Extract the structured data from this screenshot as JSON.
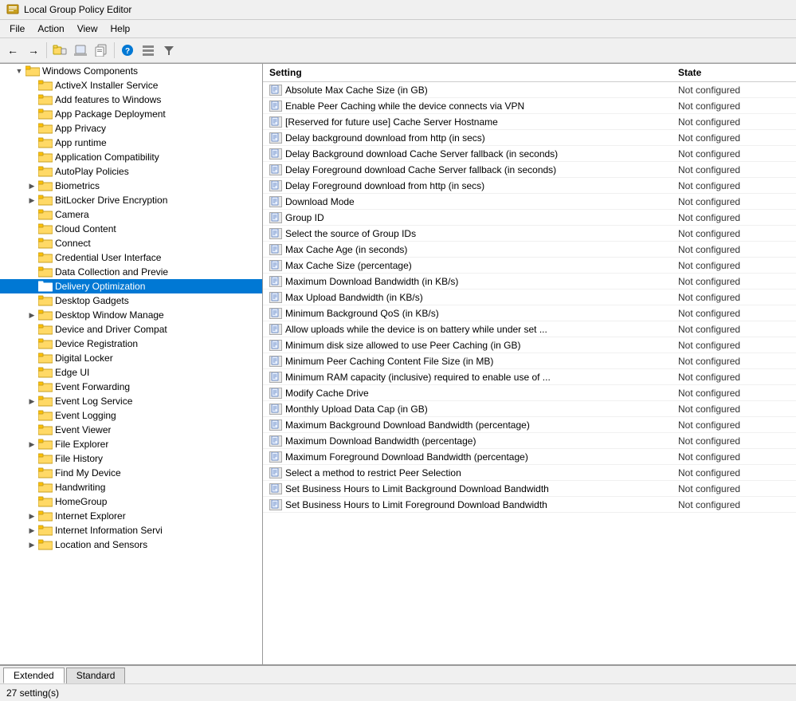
{
  "app": {
    "title": "Local Group Policy Editor",
    "menus": [
      "File",
      "Action",
      "View",
      "Help"
    ]
  },
  "toolbar": {
    "buttons": [
      "◀",
      "▶",
      "📁",
      "📋",
      "📄",
      "❓",
      "📊",
      "▼"
    ]
  },
  "tree": {
    "items": [
      {
        "id": "windows-components",
        "label": "Windows Components",
        "indent": 1,
        "expanded": true,
        "hasChildren": true,
        "selected": false
      },
      {
        "id": "activex",
        "label": "ActiveX Installer Service",
        "indent": 2,
        "expanded": false,
        "hasChildren": false,
        "selected": false
      },
      {
        "id": "add-features",
        "label": "Add features to Windows",
        "indent": 2,
        "expanded": false,
        "hasChildren": false,
        "selected": false
      },
      {
        "id": "app-package",
        "label": "App Package Deployment",
        "indent": 2,
        "expanded": false,
        "hasChildren": false,
        "selected": false
      },
      {
        "id": "app-privacy",
        "label": "App Privacy",
        "indent": 2,
        "expanded": false,
        "hasChildren": false,
        "selected": false
      },
      {
        "id": "app-runtime",
        "label": "App runtime",
        "indent": 2,
        "expanded": false,
        "hasChildren": false,
        "selected": false
      },
      {
        "id": "app-compat",
        "label": "Application Compatibility",
        "indent": 2,
        "expanded": false,
        "hasChildren": false,
        "selected": false
      },
      {
        "id": "autoplay",
        "label": "AutoPlay Policies",
        "indent": 2,
        "expanded": false,
        "hasChildren": false,
        "selected": false
      },
      {
        "id": "biometrics",
        "label": "Biometrics",
        "indent": 2,
        "expanded": false,
        "hasChildren": true,
        "selected": false
      },
      {
        "id": "bitlocker",
        "label": "BitLocker Drive Encryption",
        "indent": 2,
        "expanded": false,
        "hasChildren": true,
        "selected": false
      },
      {
        "id": "camera",
        "label": "Camera",
        "indent": 2,
        "expanded": false,
        "hasChildren": false,
        "selected": false
      },
      {
        "id": "cloud-content",
        "label": "Cloud Content",
        "indent": 2,
        "expanded": false,
        "hasChildren": false,
        "selected": false
      },
      {
        "id": "connect",
        "label": "Connect",
        "indent": 2,
        "expanded": false,
        "hasChildren": false,
        "selected": false
      },
      {
        "id": "credential-ui",
        "label": "Credential User Interface",
        "indent": 2,
        "expanded": false,
        "hasChildren": false,
        "selected": false
      },
      {
        "id": "data-collection",
        "label": "Data Collection and Previe",
        "indent": 2,
        "expanded": false,
        "hasChildren": false,
        "selected": false
      },
      {
        "id": "delivery-opt",
        "label": "Delivery Optimization",
        "indent": 2,
        "expanded": false,
        "hasChildren": false,
        "selected": true
      },
      {
        "id": "desktop-gadgets",
        "label": "Desktop Gadgets",
        "indent": 2,
        "expanded": false,
        "hasChildren": false,
        "selected": false
      },
      {
        "id": "desktop-window",
        "label": "Desktop Window Manage",
        "indent": 2,
        "expanded": false,
        "hasChildren": true,
        "selected": false
      },
      {
        "id": "device-driver",
        "label": "Device and Driver Compat",
        "indent": 2,
        "expanded": false,
        "hasChildren": false,
        "selected": false
      },
      {
        "id": "device-reg",
        "label": "Device Registration",
        "indent": 2,
        "expanded": false,
        "hasChildren": false,
        "selected": false
      },
      {
        "id": "digital-locker",
        "label": "Digital Locker",
        "indent": 2,
        "expanded": false,
        "hasChildren": false,
        "selected": false
      },
      {
        "id": "edge-ui",
        "label": "Edge UI",
        "indent": 2,
        "expanded": false,
        "hasChildren": false,
        "selected": false
      },
      {
        "id": "event-fwd",
        "label": "Event Forwarding",
        "indent": 2,
        "expanded": false,
        "hasChildren": false,
        "selected": false
      },
      {
        "id": "event-log",
        "label": "Event Log Service",
        "indent": 2,
        "expanded": false,
        "hasChildren": true,
        "selected": false
      },
      {
        "id": "event-logging",
        "label": "Event Logging",
        "indent": 2,
        "expanded": false,
        "hasChildren": false,
        "selected": false
      },
      {
        "id": "event-viewer",
        "label": "Event Viewer",
        "indent": 2,
        "expanded": false,
        "hasChildren": false,
        "selected": false
      },
      {
        "id": "file-explorer",
        "label": "File Explorer",
        "indent": 2,
        "expanded": false,
        "hasChildren": true,
        "selected": false
      },
      {
        "id": "file-history",
        "label": "File History",
        "indent": 2,
        "expanded": false,
        "hasChildren": false,
        "selected": false
      },
      {
        "id": "find-my-device",
        "label": "Find My Device",
        "indent": 2,
        "expanded": false,
        "hasChildren": false,
        "selected": false
      },
      {
        "id": "handwriting",
        "label": "Handwriting",
        "indent": 2,
        "expanded": false,
        "hasChildren": false,
        "selected": false
      },
      {
        "id": "homegroup",
        "label": "HomeGroup",
        "indent": 2,
        "expanded": false,
        "hasChildren": false,
        "selected": false
      },
      {
        "id": "internet-explorer",
        "label": "Internet Explorer",
        "indent": 2,
        "expanded": false,
        "hasChildren": true,
        "selected": false
      },
      {
        "id": "internet-info",
        "label": "Internet Information Servi",
        "indent": 2,
        "expanded": false,
        "hasChildren": true,
        "selected": false
      },
      {
        "id": "location-sensors",
        "label": "Location and Sensors",
        "indent": 2,
        "expanded": false,
        "hasChildren": true,
        "selected": false
      }
    ]
  },
  "settings": {
    "header": {
      "setting": "Setting",
      "state": "State"
    },
    "rows": [
      {
        "name": "Absolute Max Cache Size (in GB)",
        "state": "Not configured"
      },
      {
        "name": "Enable Peer Caching while the device connects via VPN",
        "state": "Not configured"
      },
      {
        "name": "[Reserved for future use] Cache Server Hostname",
        "state": "Not configured"
      },
      {
        "name": "Delay background download from http (in secs)",
        "state": "Not configured"
      },
      {
        "name": "Delay Background download Cache Server fallback (in seconds)",
        "state": "Not configured"
      },
      {
        "name": "Delay Foreground download Cache Server fallback (in seconds)",
        "state": "Not configured"
      },
      {
        "name": "Delay Foreground download from http (in secs)",
        "state": "Not configured"
      },
      {
        "name": "Download Mode",
        "state": "Not configured"
      },
      {
        "name": "Group ID",
        "state": "Not configured"
      },
      {
        "name": "Select the source of Group IDs",
        "state": "Not configured"
      },
      {
        "name": "Max Cache Age (in seconds)",
        "state": "Not configured"
      },
      {
        "name": "Max Cache Size (percentage)",
        "state": "Not configured"
      },
      {
        "name": "Maximum Download Bandwidth (in KB/s)",
        "state": "Not configured"
      },
      {
        "name": "Max Upload Bandwidth (in KB/s)",
        "state": "Not configured"
      },
      {
        "name": "Minimum Background QoS (in KB/s)",
        "state": "Not configured"
      },
      {
        "name": "Allow uploads while the device is on battery while under set ...",
        "state": "Not configured"
      },
      {
        "name": "Minimum disk size allowed to use Peer Caching (in GB)",
        "state": "Not configured"
      },
      {
        "name": "Minimum Peer Caching Content File Size (in MB)",
        "state": "Not configured"
      },
      {
        "name": "Minimum RAM capacity (inclusive) required to enable use of ...",
        "state": "Not configured"
      },
      {
        "name": "Modify Cache Drive",
        "state": "Not configured"
      },
      {
        "name": "Monthly Upload Data Cap (in GB)",
        "state": "Not configured"
      },
      {
        "name": "Maximum Background Download Bandwidth (percentage)",
        "state": "Not configured"
      },
      {
        "name": "Maximum Download Bandwidth (percentage)",
        "state": "Not configured"
      },
      {
        "name": "Maximum Foreground Download Bandwidth (percentage)",
        "state": "Not configured"
      },
      {
        "name": "Select a method to restrict Peer Selection",
        "state": "Not configured"
      },
      {
        "name": "Set Business Hours to Limit Background Download Bandwidth",
        "state": "Not configured"
      },
      {
        "name": "Set Business Hours to Limit Foreground Download Bandwidth",
        "state": "Not configured"
      }
    ]
  },
  "tabs": [
    {
      "id": "extended",
      "label": "Extended",
      "active": true
    },
    {
      "id": "standard",
      "label": "Standard",
      "active": false
    }
  ],
  "status": {
    "text": "27 setting(s)"
  }
}
